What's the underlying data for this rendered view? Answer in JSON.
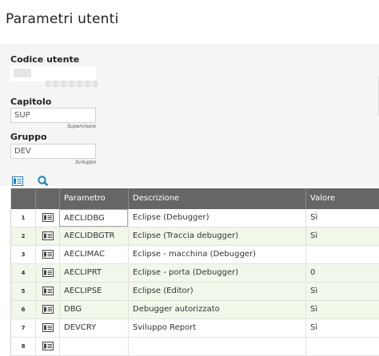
{
  "page": {
    "title": "Parametri utenti"
  },
  "form": {
    "user_code": {
      "label": "Codice utente",
      "value": ""
    },
    "chapter": {
      "label": "Capitolo",
      "value": "SUP",
      "description": "Supervisore"
    },
    "group": {
      "label": "Gruppo",
      "value": "DEV",
      "description": "Sviluppo"
    }
  },
  "toolbar": {
    "icons": [
      "detail-view-icon",
      "search-icon"
    ],
    "accent": "#1a7fc1"
  },
  "grid": {
    "columns": [
      "Parametro",
      "Descrizione",
      "Valore"
    ],
    "rows": [
      {
        "num": "1",
        "param": "AECLIDBG",
        "desc": "Eclipse (Debugger)",
        "value": "Sì"
      },
      {
        "num": "2",
        "param": "AECLIDBGTR",
        "desc": "Eclipse (Traccia debugger)",
        "value": "Sì"
      },
      {
        "num": "3",
        "param": "AECLIMAC",
        "desc": "Eclipse - macchina (Debugger)",
        "value": ""
      },
      {
        "num": "4",
        "param": "AECLIPRT",
        "desc": "Eclipse - porta (Debugger)",
        "value": "0"
      },
      {
        "num": "5",
        "param": "AECLIPSE",
        "desc": "Eclipse (Editor)",
        "value": "Sì"
      },
      {
        "num": "6",
        "param": "DBG",
        "desc": "Debugger autorizzato",
        "value": "Sì"
      },
      {
        "num": "7",
        "param": "DEVCRY",
        "desc": "Sviluppo Report",
        "value": "Sì"
      },
      {
        "num": "8",
        "param": "",
        "desc": "",
        "value": ""
      }
    ],
    "row_alt_color": "#f1f8ea",
    "header_color": "#666666"
  }
}
